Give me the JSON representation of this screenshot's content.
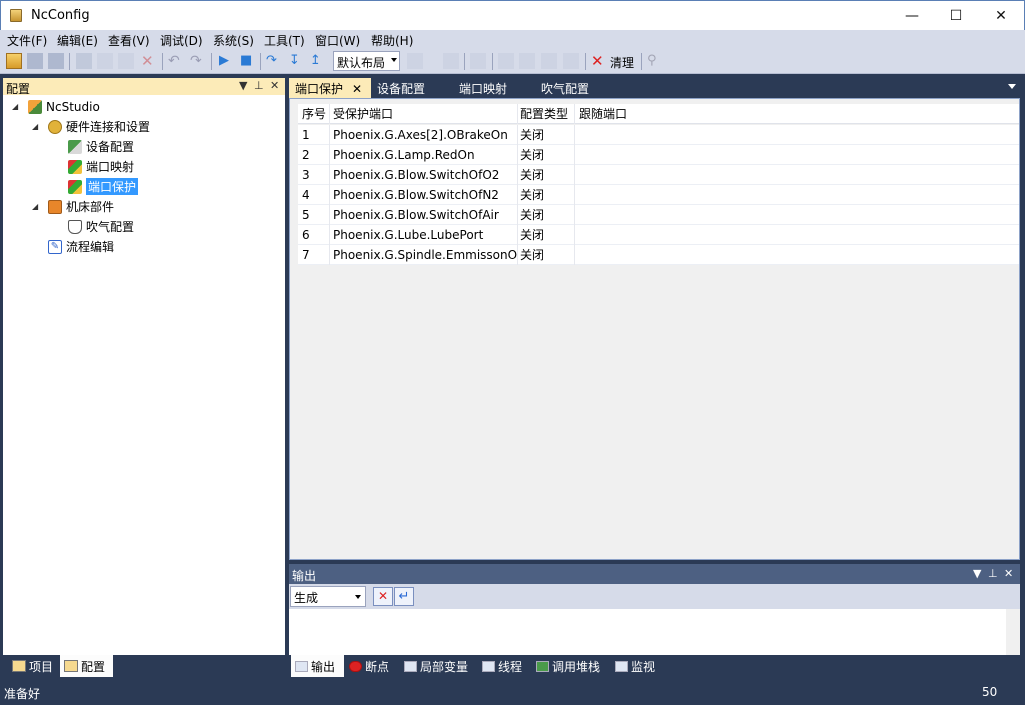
{
  "window": {
    "title": "NcConfig"
  },
  "menu": [
    "文件(F)",
    "编辑(E)",
    "查看(V)",
    "调试(D)",
    "系统(S)",
    "工具(T)",
    "窗口(W)",
    "帮助(H)"
  ],
  "toolbar": {
    "layout_value": "默认布局",
    "clear_label": "清理"
  },
  "left_panel": {
    "title": "配置",
    "tree": [
      {
        "label": "NcStudio",
        "icon": "ncstudio-icon"
      },
      {
        "label": "硬件连接和设置",
        "icon": "hardware-icon"
      },
      {
        "label": "设备配置",
        "icon": "device-config-icon"
      },
      {
        "label": "端口映射",
        "icon": "port-map-icon"
      },
      {
        "label": "端口保护",
        "icon": "port-protect-icon"
      },
      {
        "label": "机床部件",
        "icon": "machine-parts-icon"
      },
      {
        "label": "吹气配置",
        "icon": "blow-config-icon"
      },
      {
        "label": "流程编辑",
        "icon": "flow-edit-icon"
      }
    ],
    "tabs": [
      "项目",
      "配置"
    ]
  },
  "doc_tabs": [
    "端口保护",
    "设备配置",
    "端口映射",
    "吹气配置"
  ],
  "grid": {
    "columns": [
      "序号",
      "受保护端口",
      "配置类型",
      "跟随端口"
    ],
    "rows": [
      [
        "1",
        "Phoenix.G.Axes[2].OBrakeOn",
        "关闭",
        ""
      ],
      [
        "2",
        "Phoenix.G.Lamp.RedOn",
        "关闭",
        ""
      ],
      [
        "3",
        "Phoenix.G.Blow.SwitchOfO2",
        "关闭",
        ""
      ],
      [
        "4",
        "Phoenix.G.Blow.SwitchOfN2",
        "关闭",
        ""
      ],
      [
        "5",
        "Phoenix.G.Blow.SwitchOfAir",
        "关闭",
        ""
      ],
      [
        "6",
        "Phoenix.G.Lube.LubePort",
        "关闭",
        ""
      ],
      [
        "7",
        "Phoenix.G.Spindle.EmmissonOn",
        "关闭",
        ""
      ]
    ]
  },
  "output": {
    "title": "输出",
    "select_value": "生成"
  },
  "bottom_tabs": [
    "输出",
    "断点",
    "局部变量",
    "线程",
    "调用堆栈",
    "监视"
  ],
  "status": {
    "text": "准备好",
    "number": "50"
  },
  "colors": {
    "accent_header": "#fcebb8",
    "dark_bg": "#2b3a55",
    "selection": "#3399ff"
  }
}
